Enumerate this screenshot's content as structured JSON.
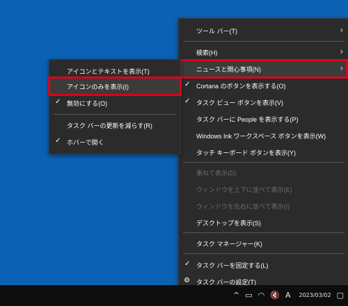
{
  "main_menu": {
    "items": [
      {
        "label": "ツール バー(T)",
        "arrow": "›"
      },
      {
        "label": "検索(H)",
        "arrow": "›"
      },
      {
        "label": "ニュースと関心事項(N)",
        "arrow": "›"
      },
      {
        "label": "Cortana のボタンを表示する(O)",
        "check": "✓"
      },
      {
        "label": "タスク ビュー ボタンを表示(V)",
        "check": "✓"
      },
      {
        "label": "タスク バーに People を表示する(P)"
      },
      {
        "label": "Windows Ink ワークスペース ボタンを表示(W)"
      },
      {
        "label": "タッチ キーボード ボタンを表示(Y)"
      },
      {
        "label": "重ねて表示(D)"
      },
      {
        "label": "ウィンドウを上下に並べて表示(E)"
      },
      {
        "label": "ウィンドウを左右に並べて表示(I)"
      },
      {
        "label": "デスクトップを表示(S)"
      },
      {
        "label": "タスク マネージャー(K)"
      },
      {
        "label": "タスク バーを固定する(L)",
        "check": "✓"
      },
      {
        "label": "タスク バーの設定(T)",
        "icon": "gear-icon"
      }
    ]
  },
  "sub_menu": {
    "items": [
      {
        "label": "アイコンとテキストを表示(T)"
      },
      {
        "label": "アイコンのみを表示(I)"
      },
      {
        "label": "無効にする(O)",
        "check": "✓"
      },
      {
        "label": "タスク バーの更新を減らす(R)"
      },
      {
        "label": "ホバーで開く",
        "check": "✓"
      }
    ]
  },
  "taskbar": {
    "tray_icons": [
      "chevron-up-icon",
      "battery-icon",
      "network-icon",
      "volume-muted-icon",
      "ime-icon",
      "notification-icon"
    ],
    "ime_label": "A",
    "date": "2023/03/02"
  },
  "colors": {
    "desktop": "#0b62b5",
    "menu_bg": "#2b2b2b",
    "highlight_border": "#e0001a"
  }
}
